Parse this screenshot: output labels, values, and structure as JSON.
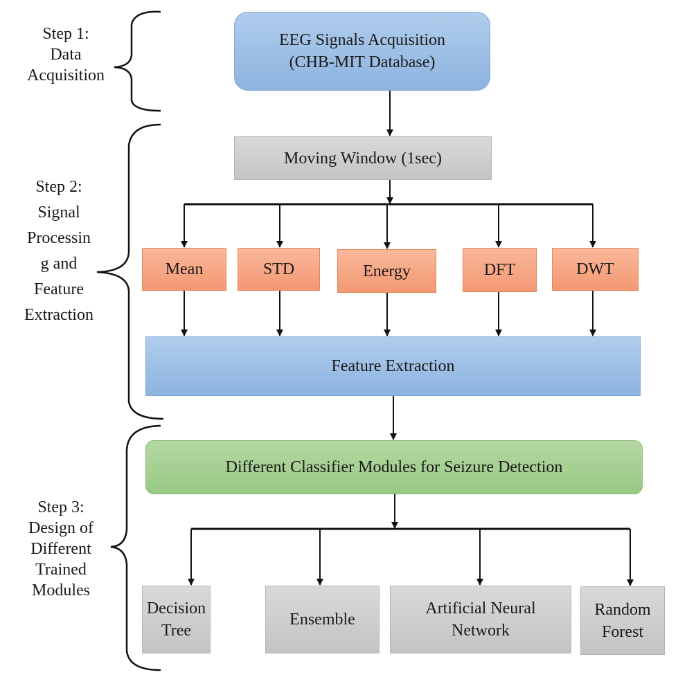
{
  "steps": [
    {
      "lines": [
        "Step 1:",
        "Data",
        "Acquisition"
      ]
    },
    {
      "lines": [
        "Step 2:",
        "Signal",
        "Processin",
        "g and",
        "Feature",
        "Extraction"
      ]
    },
    {
      "lines": [
        "Step 3:",
        "Design of",
        "Different",
        "Trained",
        "Modules"
      ]
    }
  ],
  "nodes": {
    "acquisition": [
      "EEG Signals Acquisition",
      "(CHB-MIT Database)"
    ],
    "window": "Moving Window (1sec)",
    "features": [
      "Mean",
      "STD",
      "Energy",
      "DFT",
      "DWT"
    ],
    "extraction": "Feature Extraction",
    "classifier": "Different Classifier Modules for Seizure Detection",
    "models": [
      [
        "Decision",
        "Tree"
      ],
      [
        "Ensemble"
      ],
      [
        "Artificial Neural",
        "Network"
      ],
      [
        "Random",
        "Forest"
      ]
    ]
  },
  "colors": {
    "blue": "#9dbfe6",
    "gray": "#cfcfcf",
    "orange": "#f6a783",
    "green": "#a6d092"
  }
}
